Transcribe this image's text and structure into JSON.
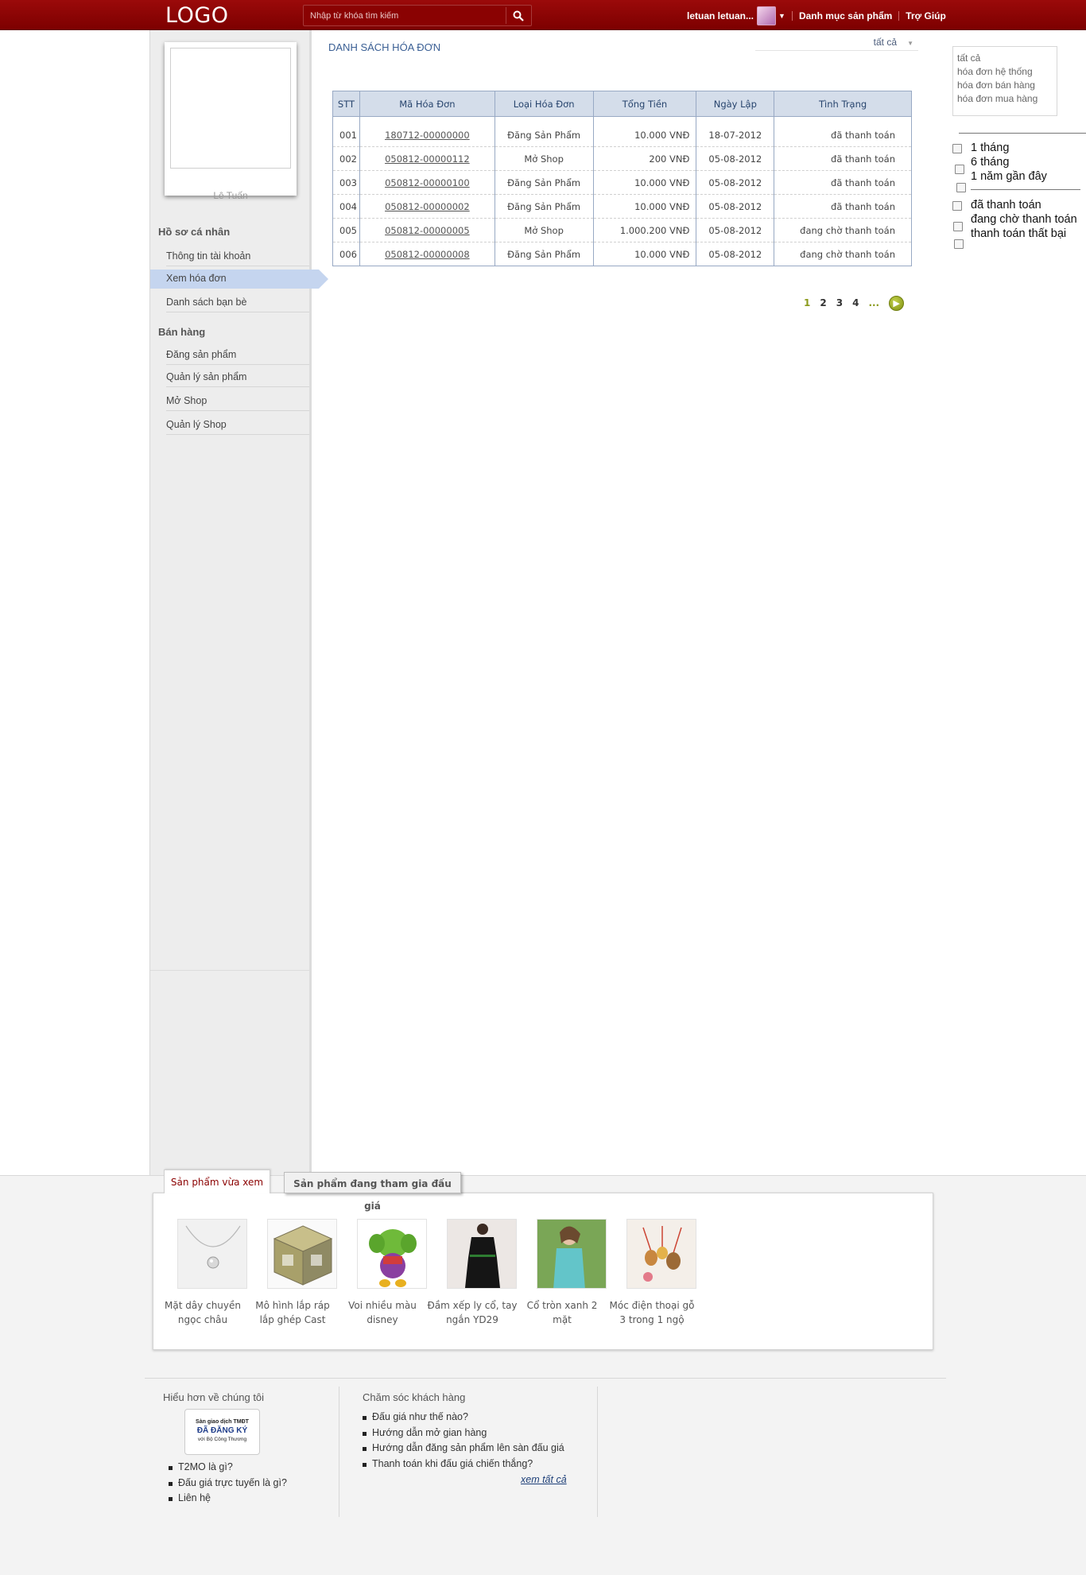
{
  "header": {
    "logo": "LOGO",
    "search_placeholder": "Nhập từ khóa tìm kiếm",
    "username": "letuan letuan...",
    "nav_categories": "Danh mục sản phẩm",
    "nav_help": "Trợ Giúp"
  },
  "profile": {
    "name": "Lê Tuấn"
  },
  "sidebar": {
    "section_profile": "Hồ sơ cá nhân",
    "profile_items": [
      {
        "label": "Thông tin tài khoản"
      },
      {
        "label": "Xem hóa đơn"
      },
      {
        "label": "Danh sách bạn bè"
      }
    ],
    "section_sales": "Bán hàng",
    "sales_items": [
      {
        "label": "Đăng sản phẩm"
      },
      {
        "label": "Quản lý sản phẩm"
      },
      {
        "label": "Mở Shop"
      },
      {
        "label": "Quản lý Shop"
      }
    ]
  },
  "main": {
    "title": "DANH SÁCH HÓA ĐƠN",
    "filter_value": "tất cả",
    "table": {
      "headers": [
        "STT",
        "Mã Hóa Đơn",
        "Loại Hóa Đơn",
        "Tổng Tiền",
        "Ngày Lập",
        "Tình Trạng"
      ],
      "rows": [
        {
          "stt": "001",
          "code": "180712-00000000",
          "type": "Đăng Sản Phẩm",
          "total": "10.000 VNĐ",
          "date": "18-07-2012",
          "status": "đã thanh toán"
        },
        {
          "stt": "002",
          "code": "050812-00000112",
          "type": "Mở Shop",
          "total": "200 VNĐ",
          "date": "05-08-2012",
          "status": "đã thanh toán"
        },
        {
          "stt": "003",
          "code": "050812-00000100",
          "type": "Đăng Sản Phẩm",
          "total": "10.000 VNĐ",
          "date": "05-08-2012",
          "status": "đã thanh toán"
        },
        {
          "stt": "004",
          "code": "050812-00000002",
          "type": "Đăng Sản Phẩm",
          "total": "10.000 VNĐ",
          "date": "05-08-2012",
          "status": "đã thanh toán"
        },
        {
          "stt": "005",
          "code": "050812-00000005",
          "type": "Mở Shop",
          "total": "1.000.200 VNĐ",
          "date": "05-08-2012",
          "status": "đang chờ thanh toán"
        },
        {
          "stt": "006",
          "code": "050812-00000008",
          "type": "Đăng Sản Phẩm",
          "total": "10.000 VNĐ",
          "date": "05-08-2012",
          "status": "đang chờ thanh toán"
        }
      ]
    },
    "pagination": {
      "pages": [
        "1",
        "2",
        "3",
        "4"
      ],
      "current": "1",
      "ellipsis": "..."
    }
  },
  "right_panel": {
    "types": [
      "tất cả",
      "hóa đơn hệ thống",
      "hóa đơn bán hàng",
      "hóa đơn mua hàng"
    ],
    "time_filters": [
      "1 tháng",
      "6 tháng",
      "1 năm gần đây"
    ],
    "status_filters": [
      "đã thanh toán",
      "đang chờ thanh toán",
      "thanh toán thất bại"
    ]
  },
  "bottom": {
    "tab_recent": "Sản phẩm vừa xem",
    "tab_auction": "Sản phẩm đang tham gia đấu giá",
    "products": [
      {
        "name": "Mặt dây chuyền ngọc châu"
      },
      {
        "name": "Mô hình lắp ráp lắp ghép Cast"
      },
      {
        "name": "Voi nhiều màu disney"
      },
      {
        "name": "Đầm xếp ly cổ, tay ngắn YD29"
      },
      {
        "name": "Cổ tròn xanh 2 mặt"
      },
      {
        "name": "Móc điện thoại gỗ 3 trong 1 ngộ"
      }
    ]
  },
  "footer": {
    "about_heading": "Hiểu hơn về chúng tôi",
    "badge_line1": "Sàn giao dịch TMĐT",
    "badge_line2": "ĐÃ ĐĂNG KÝ",
    "badge_line3": "với Bộ Công Thương",
    "about_links": [
      "T2MO là gì?",
      "Đấu giá trực tuyến là gì?",
      "Liên hệ"
    ],
    "care_heading": "Chăm sóc khách hàng",
    "care_links": [
      "Đấu giá như thế nào?",
      "Hướng dẫn mở gian hàng",
      "Hướng dẫn đăng sản phẩm lên sàn đấu giá",
      "Thanh toán khi đấu giá chiến thắng?"
    ],
    "view_all": "xem tất cả"
  },
  "colors": {
    "header_red": "#8b0000",
    "sidebar_active": "#c5d5ef",
    "table_header": "#d4ddea",
    "title_blue": "#3a5f94",
    "pagination_accent": "#8a9a1a"
  }
}
